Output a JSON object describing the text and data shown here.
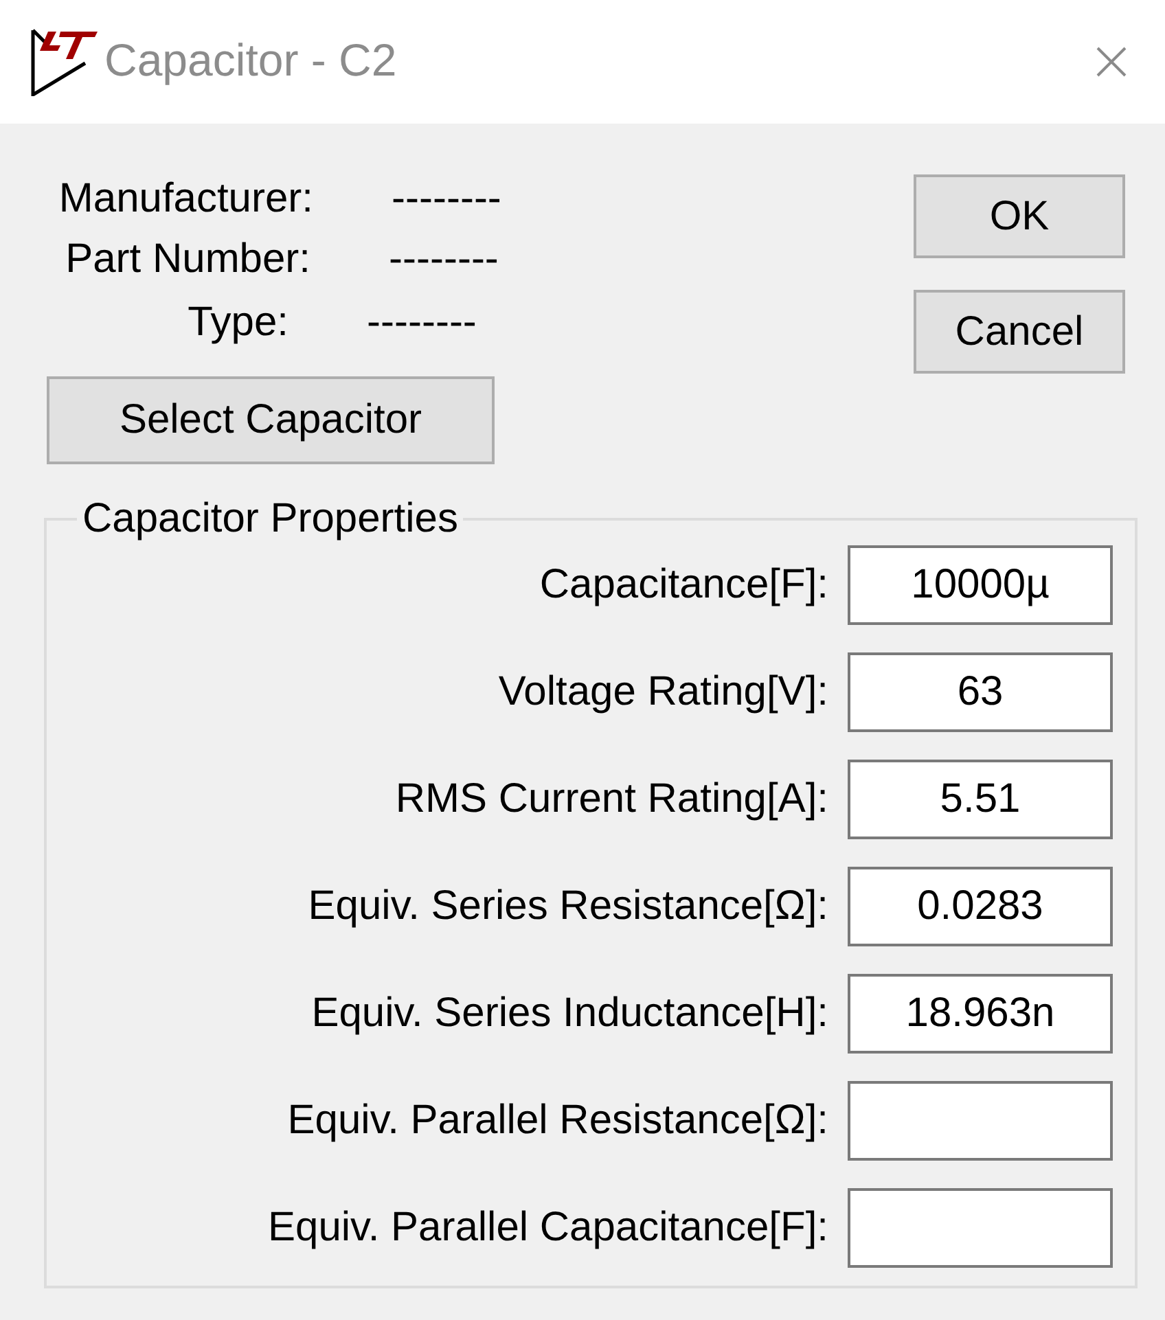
{
  "window": {
    "title": "Capacitor - C2"
  },
  "part_info": [
    {
      "label": "Manufacturer:",
      "value": "--------"
    },
    {
      "label": "Part Number:",
      "value": "--------"
    },
    {
      "label": "Type:",
      "value": "--------"
    }
  ],
  "select_button": {
    "label": "Select Capacitor"
  },
  "dialog_buttons": [
    {
      "label": "OK"
    },
    {
      "label": "Cancel"
    }
  ],
  "capacitor_properties": {
    "title": "Capacitor Properties",
    "fields": [
      {
        "label": "Capacitance[F]:",
        "value": "10000µ"
      },
      {
        "label": "Voltage Rating[V]:",
        "value": "63"
      },
      {
        "label": "RMS Current Rating[A]:",
        "value": "5.51"
      },
      {
        "label": "Equiv. Series Resistance[Ω]:",
        "value": "0.0283"
      },
      {
        "label": "Equiv. Series Inductance[H]:",
        "value": "18.963n"
      },
      {
        "label": "Equiv. Parallel Resistance[Ω]:"
      },
      {
        "label": "Equiv. Parallel Capacitance[F]:"
      }
    ]
  }
}
